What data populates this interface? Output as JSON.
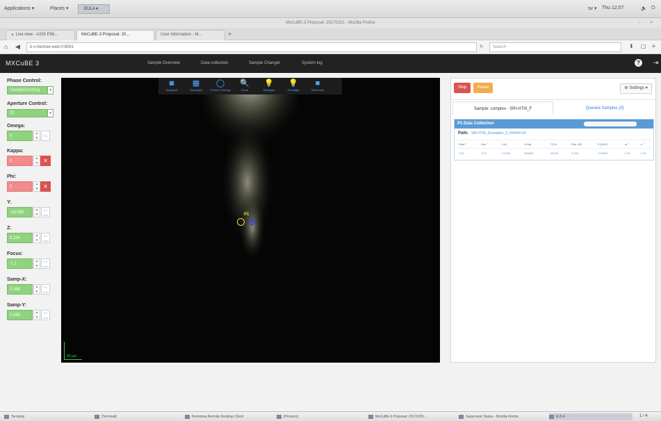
{
  "gnome": {
    "applications": "Applications ▾",
    "places": "Places ▾",
    "eula": "EULA ▾",
    "lang": "sv ▾",
    "clock": "Thu 12:07",
    "volume": "🔈",
    "power": "⏻"
  },
  "firefox": {
    "window_title": "MxCuBE-3 Proposal: 20170251 - Mozilla Firefox",
    "tabs": [
      {
        "label": "Live view - AXIS P56..."
      },
      {
        "label": "MxCuBE-3 Proposal: 20..."
      },
      {
        "label": "User information - M..."
      }
    ],
    "new_tab": "+",
    "url": "b-v-biomax-web-0:8081",
    "search_placeholder": "Search"
  },
  "mx": {
    "brand": "MXCuBE 3",
    "nav": [
      "Sample Overview",
      "Data collection",
      "Sample Changer",
      "System log"
    ]
  },
  "controls": {
    "phase_label": "Phase Control:",
    "phase_value": "SampleCentring",
    "aperture_label": "Aperture Control:",
    "aperture_value": "20",
    "omega_label": "Omega:",
    "omega_value": "0",
    "omega_step": "90",
    "kappa_label": "Kappa:",
    "kappa_value": "0",
    "phi_label": "Phi:",
    "phi_value": "0",
    "y_label": "Y:",
    "y_value": "-18.555",
    "y_step": "0.1",
    "y_unit": "mm",
    "z_label": "Z:",
    "z_value": "0.224",
    "z_step": "0.1",
    "z_unit": "mm",
    "focus_label": "Focus:",
    "focus_value": "-1.1",
    "focus_step": "0.1",
    "focus_unit": "mm",
    "sampx_label": "Samp-X:",
    "sampx_value": "0.369",
    "sampx_step": "0.1",
    "sampx_unit": "mm",
    "sampy_label": "Samp-Y:",
    "sampy_value": "0.093",
    "sampy_step": "0.1",
    "sampy_unit": "mm"
  },
  "video": {
    "tools": [
      {
        "label": "Snapshot",
        "icon": "camera-icon",
        "glyph": "◙"
      },
      {
        "label": "Draw grid",
        "icon": "grid-icon",
        "glyph": "▦"
      },
      {
        "label": "3-Click Centring",
        "icon": "centring-icon",
        "glyph": "◯"
      },
      {
        "label": "Zoom",
        "icon": "zoom-icon",
        "glyph": "🔍"
      },
      {
        "label": "Backlight",
        "icon": "backlight-icon",
        "glyph": "💡"
      },
      {
        "label": "Frontlight",
        "icon": "frontlight-icon",
        "glyph": "💡"
      },
      {
        "label": "Video size",
        "icon": "video-icon",
        "glyph": "■"
      }
    ],
    "point_label": "P1",
    "scale_label": "50 µm"
  },
  "queue": {
    "stop": "Stop",
    "pause": "Pause",
    "settings": "⚙ Settings ▾",
    "tab_current": "Sample: complex - SRI-HTI9_F",
    "tab_queued": "Queued Samples (0)",
    "dc_title": "P1 Data Collection",
    "path_label": "Path:",
    "path_value": "SRI-HTI9_F/complex_2_######.h5",
    "headers": [
      "Start °",
      "Osc. °",
      "t (s)",
      "# Img",
      "T (%)",
      "Res. (Å)",
      "E (KeV)",
      "φ °",
      "κ °"
    ],
    "values": [
      "0.00",
      "0.10",
      "0.0100",
      "100000",
      "100.00",
      "2.100",
      "13.0000",
      "0.00",
      "0.00"
    ]
  },
  "taskbar": {
    "items": [
      "Terminal",
      "[Terminal]",
      "Remmina Remote Desktop Client",
      "[Pictures]",
      "MxCuBE-3 Proposal: 20170251...",
      "Supervisor Status - Mozilla Firefox",
      "EULA"
    ],
    "workspace": "1 / 4"
  },
  "colors": {
    "green_field": "#8fd37e",
    "red_field": "#f28b8b",
    "stop_red": "#d9534f",
    "pause_orange": "#f0ad4e",
    "dc_blue": "#5b9bd5",
    "nav_dark": "#222222"
  }
}
